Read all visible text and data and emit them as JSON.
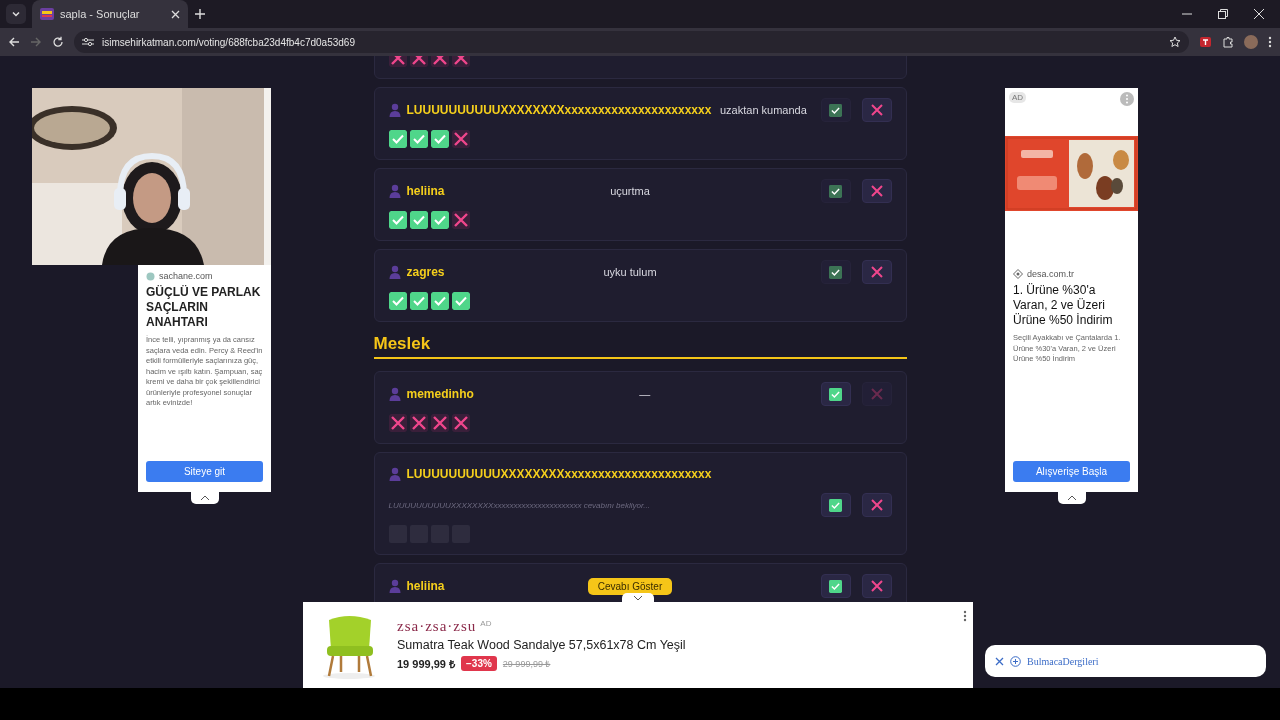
{
  "browser": {
    "tabs": [
      {
        "title": "sapla - Sonuçlar",
        "selected": true
      }
    ],
    "url": "isimsehirkatman.com/voting/688fcba23d4fb4c7d0a53d69"
  },
  "left_ad": {
    "domain": "sachane.com",
    "headline": "GÜÇLÜ VE PARLAK SAÇLARIN ANAHTARI",
    "body": "İnce telli, yıpranmış ya da cansız saçlara veda edin. Percy & Reed'in etkili formülleriyle saçlarınıza güç, hacim ve ışıltı katın. Şampuan, saç kremi ve daha bir çok şekillendirici ürünleriyle profesyonel sonuçlar artık evinizde!",
    "button": "Siteye git"
  },
  "answers": [
    {
      "results": [
        {
          "correct": false
        },
        {
          "correct": false
        },
        {
          "correct": false
        },
        {
          "correct": false
        }
      ]
    },
    {
      "name": "LUUUUUUUUUUXXXXXXXXxxxxxxxxxxxxxxxxxxxxxx",
      "answer": "uzaktan kumanda",
      "approve": {
        "dimmed": true
      },
      "reject": {
        "dimmed": false
      },
      "results": [
        {
          "correct": true
        },
        {
          "correct": true
        },
        {
          "correct": true
        },
        {
          "correct": false
        }
      ]
    },
    {
      "name": "heliina",
      "answer": "uçurtma",
      "approve": {
        "dimmed": true
      },
      "reject": {
        "dimmed": false
      },
      "results": [
        {
          "correct": true
        },
        {
          "correct": true
        },
        {
          "correct": true
        },
        {
          "correct": false
        }
      ]
    },
    {
      "name": "zagres",
      "answer": "uyku tulum",
      "approve": {
        "dimmed": true
      },
      "reject": {
        "dimmed": false
      },
      "results": [
        {
          "correct": true
        },
        {
          "correct": true
        },
        {
          "correct": true
        },
        {
          "correct": true
        }
      ]
    }
  ],
  "sections": [
    {
      "title": "Meslek",
      "answers": [
        {
          "name": "memedinho",
          "answer": "—",
          "approve": {
            "dimmed": false
          },
          "reject": {
            "dimmed": true
          },
          "results": [
            {
              "correct": false
            },
            {
              "correct": false
            },
            {
              "correct": false
            },
            {
              "correct": false
            }
          ]
        },
        {
          "name": "LUUUUUUUUUUXXXXXXXXxxxxxxxxxxxxxxxxxxxxxx",
          "waiting_text": "LUUUUUUUUUUXXXXXXXXxxxxxxxxxxxxxxxxxxxxxx cevabını bekliyor...",
          "approve": {
            "dimmed": false
          },
          "reject": {
            "dimmed": false
          },
          "results": [
            {
              "pending": true
            },
            {
              "pending": true
            },
            {
              "pending": true
            },
            {
              "pending": true
            }
          ]
        },
        {
          "name": "heliina",
          "reveal_button": "Cevabı Göster",
          "approve": {
            "dimmed": false
          },
          "reject": {
            "dimmed": false
          }
        }
      ]
    }
  ],
  "right_ad": {
    "badge": "AD",
    "domain": "desa.com.tr",
    "headline": "1. Ürüne %30'a Varan, 2 ve Üzeri Ürüne %50 İndirim",
    "body": "Seçili Ayakkabı ve Çantalarda 1. Ürüne %30'a Varan, 2 ve Üzeri Ürüne %50 İndirim",
    "button": "Alışverişe Başla"
  },
  "bottom_ad": {
    "brand": "zsa·zsa·zsu",
    "badge": "AD",
    "title": "Sumatra Teak Wood Sandalye 57,5x61x78 Cm Yeşil",
    "price": "19 999,99 ₺",
    "discount": "−33%",
    "old_price": "29 999,99 ₺"
  },
  "toast": {
    "label": "BulmacaDergileri"
  }
}
